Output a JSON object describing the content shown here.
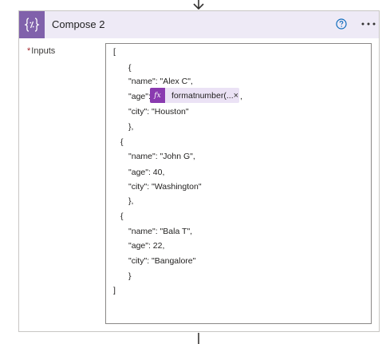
{
  "action": {
    "title": "Compose 2",
    "icon": "curly-braces-icon",
    "help_icon": "help-circle-icon",
    "more_icon": "more-options-icon",
    "accent_color": "#8061ab",
    "header_bg": "#eeeaf6"
  },
  "inputs": {
    "required_marker": "*",
    "label": "Inputs",
    "lines": [
      "[",
      "{",
      "\"name\": \"Alex C\",",
      "\"age\":",
      ",",
      "\"city\": \"Houston\"",
      "},",
      "{",
      "\"name\": \"John G\",",
      "\"age\": 40,",
      "\"city\": \"Washington\"",
      "},",
      "{",
      "\"name\": \"Bala T\",",
      "\"age\": 22,",
      "\"city\": \"Bangalore\"",
      "}",
      "]"
    ],
    "token": {
      "icon_text": "fx",
      "label": "formatnumber(...",
      "close": "×",
      "color": "#8a3ab0"
    }
  }
}
